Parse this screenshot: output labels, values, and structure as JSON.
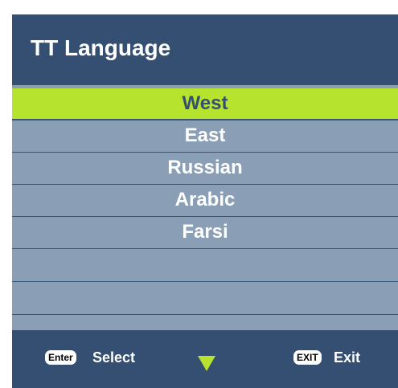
{
  "menu": {
    "title": "TT Language",
    "items": [
      {
        "label": "West",
        "selected": true
      },
      {
        "label": "East",
        "selected": false
      },
      {
        "label": "Russian",
        "selected": false
      },
      {
        "label": "Arabic",
        "selected": false
      },
      {
        "label": "Farsi",
        "selected": false
      },
      {
        "label": "",
        "selected": false
      },
      {
        "label": "",
        "selected": false
      }
    ]
  },
  "footer": {
    "enter_key": "Enter",
    "select_label": "Select",
    "exit_key": "EXIT",
    "exit_label": "Exit",
    "scroll_icon": "triangle-down-icon"
  },
  "colors": {
    "header_bg": "#354f73",
    "list_bg": "#8a9fb5",
    "highlight": "#b6e32d"
  }
}
